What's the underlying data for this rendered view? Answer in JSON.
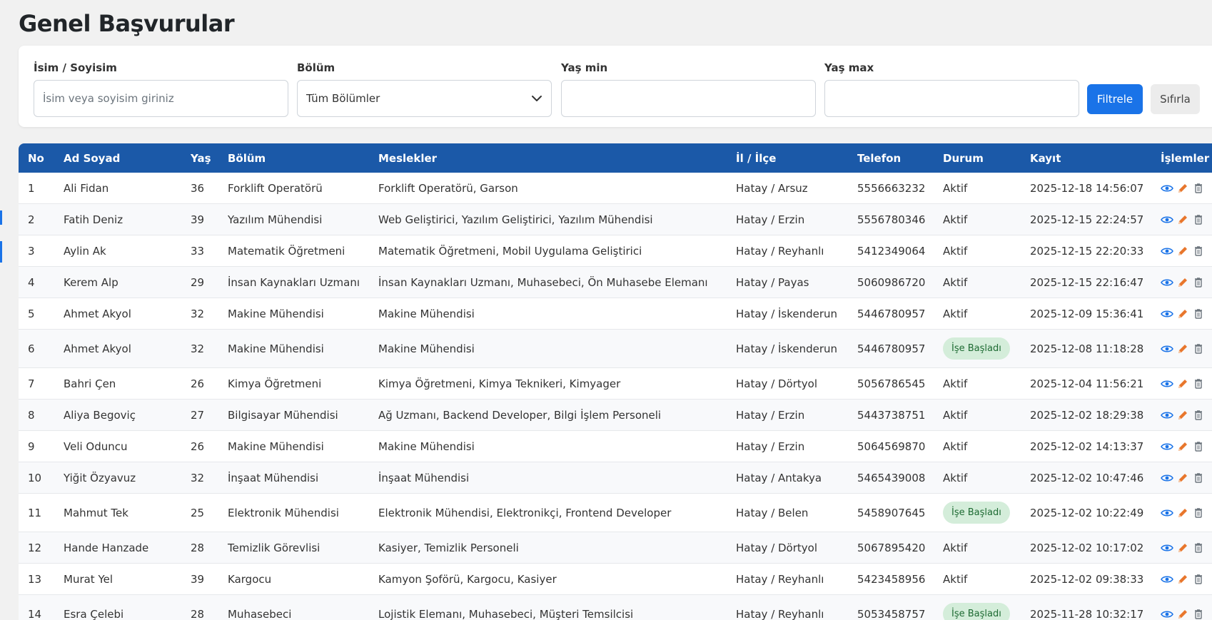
{
  "page": {
    "title": "Genel Başvurular"
  },
  "filters": {
    "name": {
      "label": "İsim / Soyisim",
      "placeholder": "İsim veya soyisim giriniz",
      "value": ""
    },
    "department": {
      "label": "Bölüm",
      "selected": "Tüm Bölümler"
    },
    "age_min": {
      "label": "Yaş min",
      "value": ""
    },
    "age_max": {
      "label": "Yaş max",
      "value": ""
    },
    "filter_button": "Filtrele",
    "reset_button": "Sıfırla"
  },
  "table": {
    "headers": [
      "No",
      "Ad Soyad",
      "Yaş",
      "Bölüm",
      "Meslekler",
      "İl / İlçe",
      "Telefon",
      "Durum",
      "Kayıt",
      "İşlemler"
    ],
    "rows": [
      [
        "1",
        "Ali Fidan",
        "36",
        "Forklift Operatörü",
        "Forklift Operatörü, Garson",
        "Hatay / Arsuz",
        "5556663232",
        "Aktif",
        "2025-12-18 14:56:07"
      ],
      [
        "2",
        "Fatih Deniz",
        "39",
        "Yazılım Mühendisi",
        "Web Geliştirici, Yazılım Geliştirici, Yazılım Mühendisi",
        "Hatay / Erzin",
        "5556780346",
        "Aktif",
        "2025-12-15 22:24:57"
      ],
      [
        "3",
        "Aylin Ak",
        "33",
        "Matematik Öğretmeni",
        "Matematik Öğretmeni, Mobil Uygulama Geliştirici",
        "Hatay / Reyhanlı",
        "5412349064",
        "Aktif",
        "2025-12-15 22:20:33"
      ],
      [
        "4",
        "Kerem Alp",
        "29",
        "İnsan Kaynakları Uzmanı",
        "İnsan Kaynakları Uzmanı, Muhasebeci, Ön Muhasebe Elemanı",
        "Hatay / Payas",
        "5060986720",
        "Aktif",
        "2025-12-15 22:16:47"
      ],
      [
        "5",
        "Ahmet Akyol",
        "32",
        "Makine Mühendisi",
        "Makine Mühendisi",
        "Hatay / İskenderun",
        "5446780957",
        "Aktif",
        "2025-12-09 15:36:41"
      ],
      [
        "6",
        "Ahmet Akyol",
        "32",
        "Makine Mühendisi",
        "Makine Mühendisi",
        "Hatay / İskenderun",
        "5446780957",
        "İşe Başladı",
        "2025-12-08 11:18:28"
      ],
      [
        "7",
        "Bahri Çen",
        "26",
        "Kimya Öğretmeni",
        "Kimya Öğretmeni, Kimya Teknikeri, Kimyager",
        "Hatay / Dörtyol",
        "5056786545",
        "Aktif",
        "2025-12-04 11:56:21"
      ],
      [
        "8",
        "Aliya Begoviç",
        "27",
        "Bilgisayar Mühendisi",
        "Ağ Uzmanı, Backend Developer, Bilgi İşlem Personeli",
        "Hatay / Erzin",
        "5443738751",
        "Aktif",
        "2025-12-02 18:29:38"
      ],
      [
        "9",
        "Veli Oduncu",
        "26",
        "Makine Mühendisi",
        "Makine Mühendisi",
        "Hatay / Erzin",
        "5064569870",
        "Aktif",
        "2025-12-02 14:13:37"
      ],
      [
        "10",
        "Yiğit Özyavuz",
        "32",
        "İnşaat Mühendisi",
        "İnşaat Mühendisi",
        "Hatay / Antakya",
        "5465439008",
        "Aktif",
        "2025-12-02 10:47:46"
      ],
      [
        "11",
        "Mahmut Tek",
        "25",
        "Elektronik Mühendisi",
        "Elektronik Mühendisi, Elektronikçi, Frontend Developer",
        "Hatay / Belen",
        "5458907645",
        "İşe Başladı",
        "2025-12-02 10:22:49"
      ],
      [
        "12",
        "Hande Hanzade",
        "28",
        "Temizlik Görevlisi",
        "Kasiyer, Temizlik Personeli",
        "Hatay / Dörtyol",
        "5067895420",
        "Aktif",
        "2025-12-02 10:17:02"
      ],
      [
        "13",
        "Murat Yel",
        "39",
        "Kargocu",
        "Kamyon Şoförü, Kargocu, Kasiyer",
        "Hatay / Reyhanlı",
        "5423458956",
        "Aktif",
        "2025-12-02 09:38:33"
      ],
      [
        "14",
        "Esra Çelebi",
        "28",
        "Muhasebeci",
        "Lojistik Elemanı, Muhasebeci, Müşteri Temsilcisi",
        "Hatay / Reyhanlı",
        "5053458757",
        "İşe Başladı",
        "2025-11-28 10:32:17"
      ]
    ],
    "action_icons": [
      "eye-icon",
      "pencil-icon",
      "trash-icon"
    ]
  },
  "colors": {
    "header_bg": "#1b59a8",
    "primary_button": "#1a73e8",
    "badge_bg": "#d4edda",
    "badge_text": "#1e6b33",
    "view_icon": "#1a73e8",
    "edit_icon": "#e8762c",
    "delete_icon": "#6c757d"
  }
}
